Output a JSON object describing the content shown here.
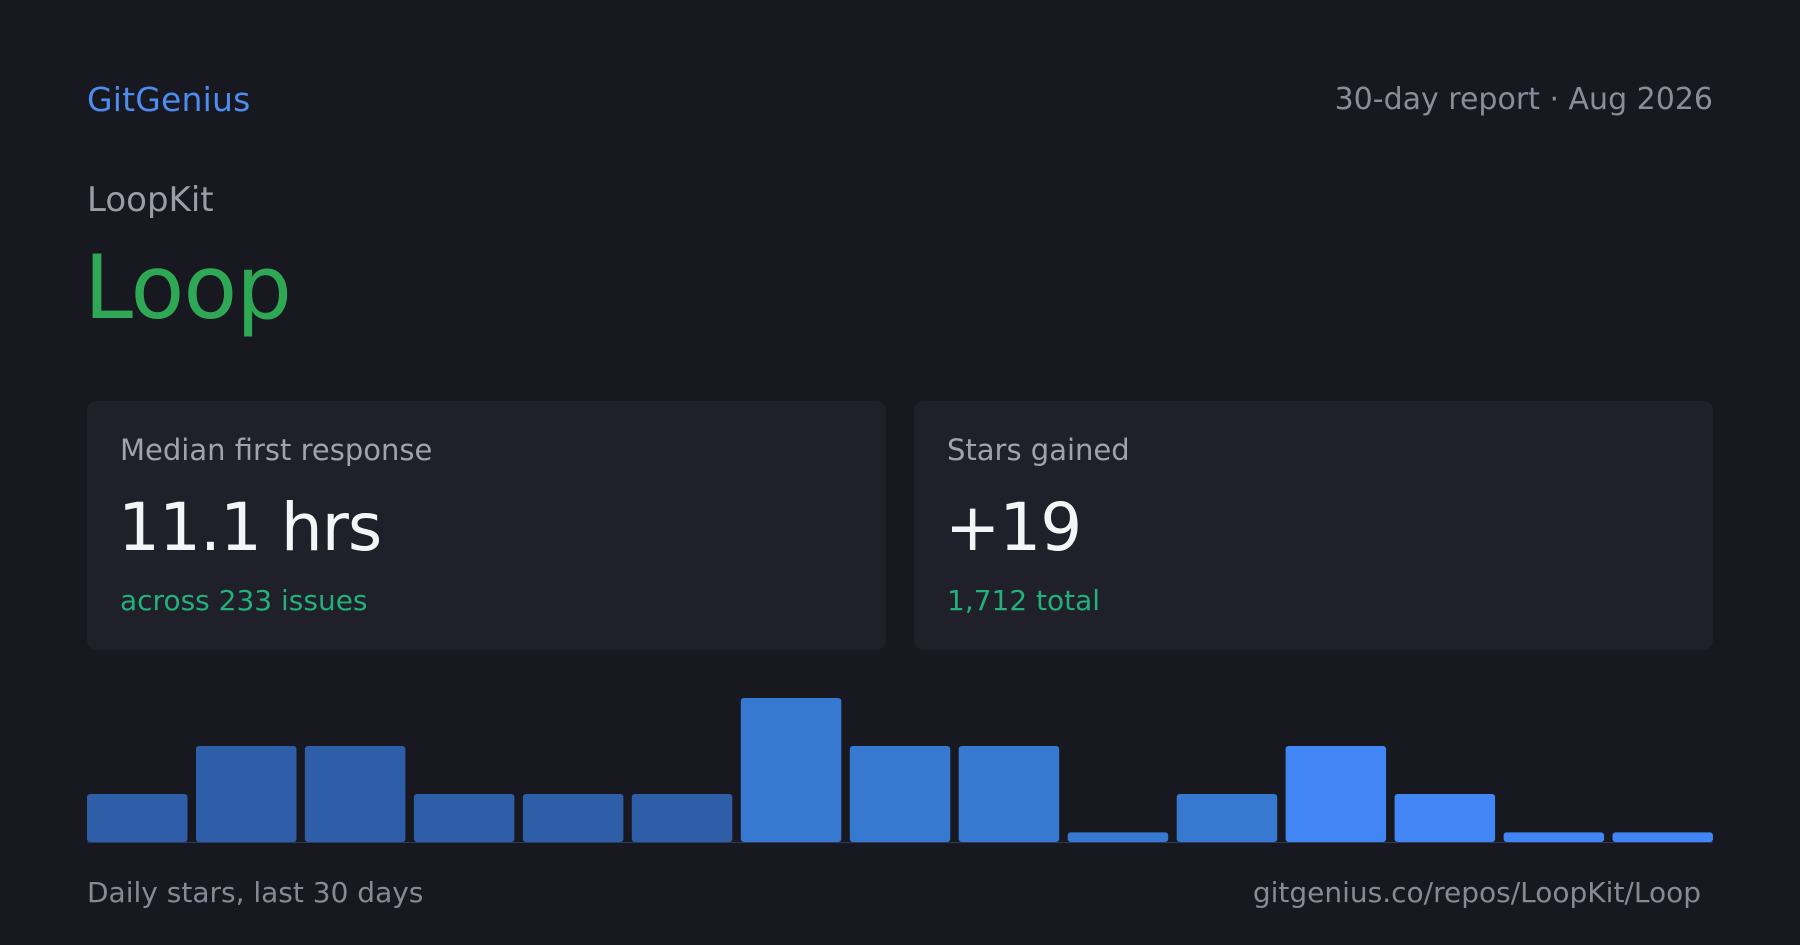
{
  "header": {
    "brand": "GitGenius",
    "report_label": "30-day report · Aug 2026"
  },
  "repo": {
    "owner": "LoopKit",
    "name": "Loop"
  },
  "cards": [
    {
      "label": "Median first response",
      "value": "11.1 hrs",
      "sub": "across 233 issues"
    },
    {
      "label": "Stars gained",
      "value": "+19",
      "sub": "1,712 total"
    }
  ],
  "footer": {
    "caption": "Daily stars, last 30 days",
    "url": "gitgenius.co/repos/LoopKit/Loop"
  },
  "colors": {
    "background": "#171820",
    "brand": "#4f8cf0",
    "repo_name": "#2fa856",
    "card_background": "#1f2029",
    "positive": "#23b07a",
    "bar_dark": "#2f5ea8",
    "bar_mid": "#3778d0",
    "bar_bright": "#4285f4"
  },
  "chart_data": {
    "type": "bar",
    "values": [
      2,
      4,
      4,
      2,
      2,
      2,
      6,
      4,
      4,
      0.4,
      2,
      4,
      2,
      0.4,
      0.4
    ],
    "ylim": [
      0,
      6
    ],
    "grid": false,
    "legend": "none"
  }
}
